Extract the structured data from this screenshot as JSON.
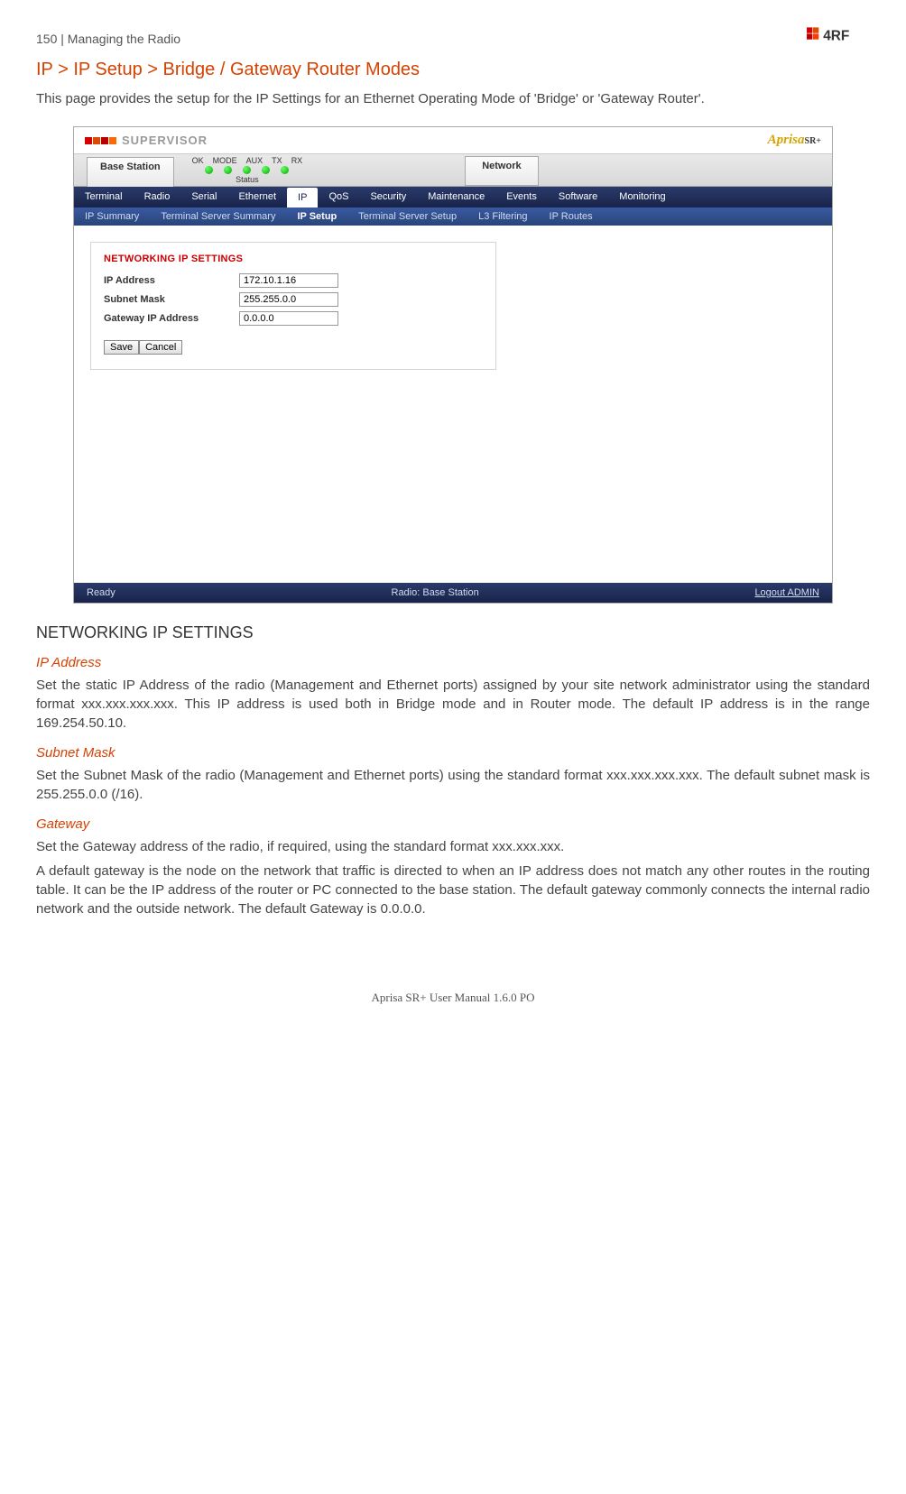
{
  "page_header": {
    "num": "150",
    "sep": "|",
    "title": "Managing the Radio"
  },
  "section_title": "IP > IP Setup > Bridge / Gateway Router Modes",
  "intro_text": "This page provides the setup for the IP Settings for an Ethernet Operating Mode of 'Bridge' or 'Gateway Router'.",
  "app": {
    "supervisor_label": "SUPERVISOR",
    "aprisa_label": "Aprisa",
    "aprisa_sr": "SR+",
    "station_tab": "Base Station",
    "status_head": [
      "OK",
      "MODE",
      "AUX",
      "TX",
      "RX"
    ],
    "status_word": "Status",
    "network_tab": "Network",
    "nav_main": [
      "Terminal",
      "Radio",
      "Serial",
      "Ethernet",
      "IP",
      "QoS",
      "Security",
      "Maintenance",
      "Events",
      "Software",
      "Monitoring"
    ],
    "nav_main_active": "IP",
    "nav_sub": [
      "IP Summary",
      "Terminal Server Summary",
      "IP Setup",
      "Terminal Server Setup",
      "L3 Filtering",
      "IP Routes"
    ],
    "nav_sub_active": "IP Setup",
    "settings_title": "NETWORKING IP SETTINGS",
    "fields": {
      "ip_label": "IP Address",
      "ip_value": "172.10.1.16",
      "mask_label": "Subnet Mask",
      "mask_value": "255.255.0.0",
      "gw_label": "Gateway IP Address",
      "gw_value": "0.0.0.0"
    },
    "buttons": {
      "save": "Save",
      "cancel": "Cancel"
    },
    "status_bar": {
      "left": "Ready",
      "center": "Radio: Base Station",
      "right": "Logout ADMIN"
    }
  },
  "networking_heading": "NETWORKING IP SETTINGS",
  "ip_address": {
    "label": "IP Address",
    "text": "Set the static IP Address of the radio (Management and Ethernet ports) assigned by your site network administrator using the standard format xxx.xxx.xxx.xxx. This IP address is used both in Bridge mode and in Router mode. The default IP address is in the range 169.254.50.10."
  },
  "subnet": {
    "label": "Subnet Mask",
    "text": "Set the Subnet Mask of the radio (Management and Ethernet ports) using the standard format xxx.xxx.xxx.xxx. The default subnet mask is 255.255.0.0 (/16)."
  },
  "gateway": {
    "label": "Gateway",
    "text1": "Set the Gateway address of the radio, if required, using the standard format xxx.xxx.xxx.",
    "text2": "A default gateway is the node on the network that traffic is directed to when an IP address does not match any other routes in the routing table. It can be the IP address of the router or PC connected to the base station. The default gateway commonly connects the internal radio network and the outside network. The default Gateway is 0.0.0.0."
  },
  "footer": "Aprisa SR+ User Manual 1.6.0 PO"
}
